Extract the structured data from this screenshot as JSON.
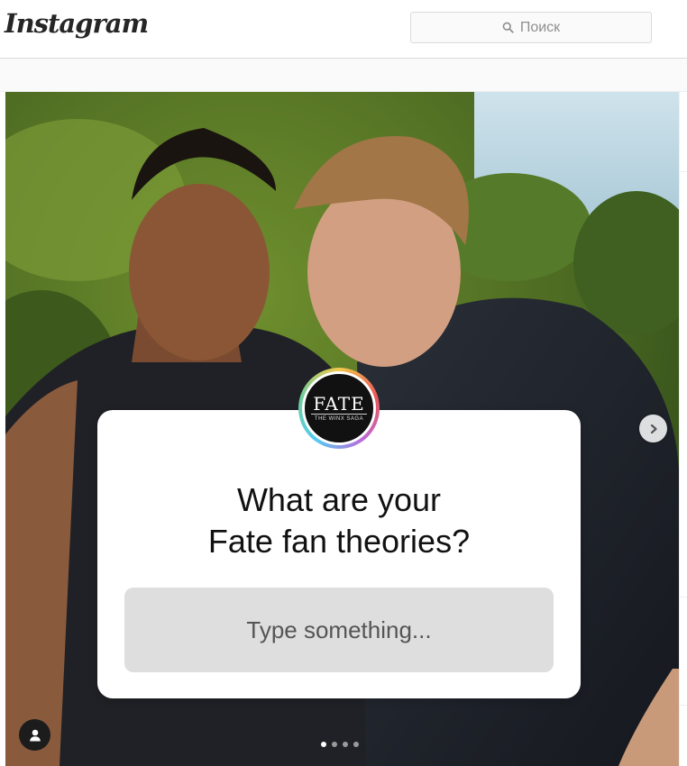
{
  "header": {
    "logo": "Instagram",
    "search": {
      "placeholder": "Поиск",
      "icon": "search-icon"
    }
  },
  "story": {
    "sticker_brand": "FATE",
    "sticker_brand_sub": "THE WINX SAGA",
    "question_lines": [
      "What are your",
      "Fate fan theories?"
    ],
    "answer_placeholder": "Type something...",
    "slides_total": 4,
    "slide_active_index": 0,
    "next_icon": "chevron-right-icon",
    "profile_icon": "user-icon"
  },
  "colors": {
    "background": "#ffffff",
    "border": "#dbdbdb",
    "card": "#ffffff",
    "answer_box": "#dedede",
    "text_muted": "#8e8e8e"
  }
}
